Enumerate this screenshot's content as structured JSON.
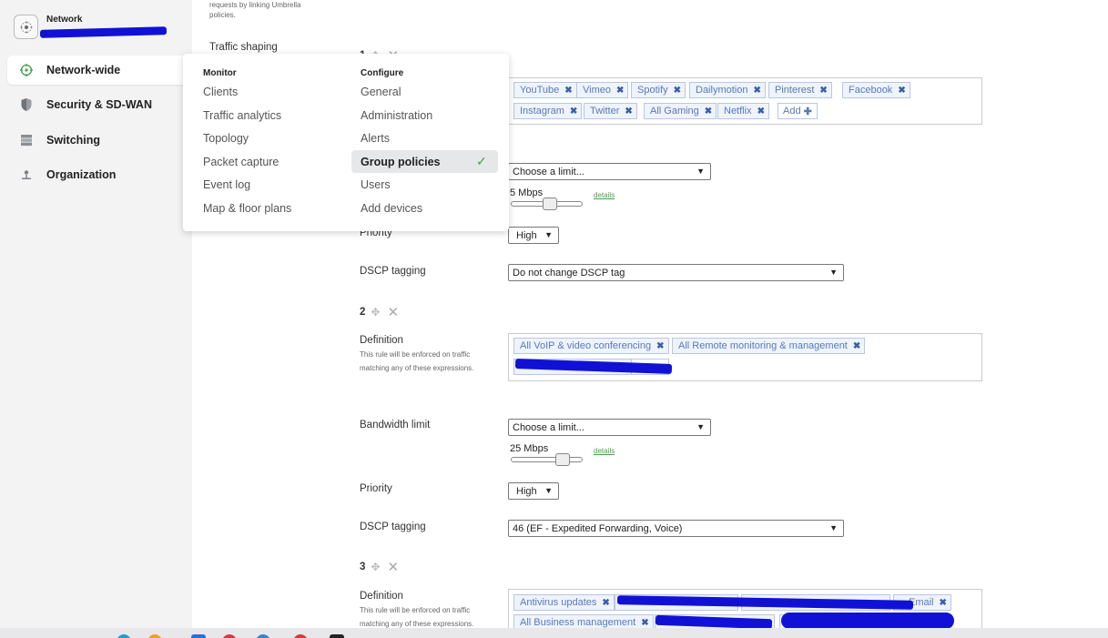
{
  "sidebar": {
    "network_label": "Network",
    "items": [
      {
        "label": "Network-wide",
        "icon": "network-wide-icon"
      },
      {
        "label": "Security & SD-WAN",
        "icon": "shield-icon"
      },
      {
        "label": "Switching",
        "icon": "switch-icon"
      },
      {
        "label": "Organization",
        "icon": "organization-icon"
      }
    ]
  },
  "menu": {
    "monitor_header": "Monitor",
    "configure_header": "Configure",
    "monitor_items": [
      "Clients",
      "Traffic analytics",
      "Topology",
      "Packet capture",
      "Event log",
      "Map & floor plans"
    ],
    "configure_items": [
      "General",
      "Administration",
      "Alerts",
      "Group policies",
      "Users",
      "Add devices"
    ]
  },
  "content": {
    "top_note_1": "requests by linking Umbrella",
    "top_note_2": "policies.",
    "traffic_shaping": "Traffic shaping",
    "rule1": {
      "number": "1",
      "tags": [
        "YouTube",
        "Vimeo",
        "Spotify",
        "Dailymotion",
        "Pinterest",
        "Facebook",
        "Instagram",
        "Twitter",
        "All Gaming",
        "Netflix"
      ],
      "add_label": "Add",
      "bandwidth_select": "Choose a limit...",
      "bandwidth_value": "5 Mbps",
      "details": "details",
      "priority_label": "Priority",
      "priority_value": "High",
      "dscp_label": "DSCP tagging",
      "dscp_value": "Do not change DSCP tag"
    },
    "rule2": {
      "number": "2",
      "definition_label": "Definition",
      "definition_note_1": "This rule will be enforced on traffic",
      "definition_note_2": "matching any of these expressions.",
      "tags": [
        "All VoIP & video conferencing",
        "All Remote monitoring & management"
      ],
      "bandwidth_label": "Bandwidth limit",
      "bandwidth_select": "Choose a limit...",
      "bandwidth_value": "25 Mbps",
      "details": "details",
      "priority_label": "Priority",
      "priority_value": "High",
      "dscp_label": "DSCP tagging",
      "dscp_value": "46 (EF - Expedited Forwarding, Voice)"
    },
    "rule3": {
      "number": "3",
      "definition_label": "Definition",
      "definition_note_1": "This rule will be enforced on traffic",
      "definition_note_2": "matching any of these expressions.",
      "tags": [
        "Antivirus updates",
        "Email",
        "All Business management"
      ]
    }
  },
  "colors": {
    "accent_green": "#45a04a",
    "tag_blue": "#5a7ab8",
    "redaction_blue": "#1111d6"
  }
}
